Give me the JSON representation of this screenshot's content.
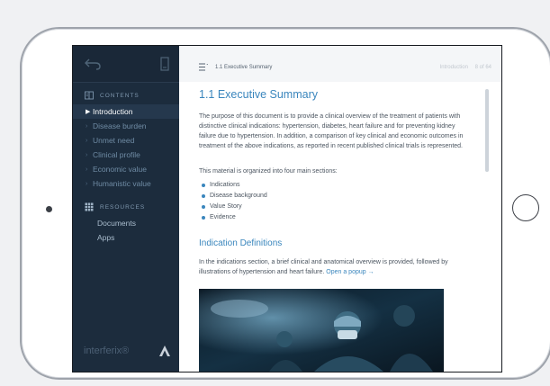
{
  "sidebar": {
    "contents_heading": "CONTENTS",
    "nav_items": [
      {
        "label": "Introduction",
        "active": true
      },
      {
        "label": "Disease burden",
        "active": false
      },
      {
        "label": "Unmet need",
        "active": false
      },
      {
        "label": "Clinical profile",
        "active": false
      },
      {
        "label": "Economic value",
        "active": false
      },
      {
        "label": "Humanistic value",
        "active": false
      }
    ],
    "resources_heading": "RESOURCES",
    "resources": [
      "Documents",
      "Apps"
    ],
    "brand": "interferix®"
  },
  "topbar": {
    "title": "1.1 Executive Summary",
    "section": "Introduction",
    "page": "8 of 64"
  },
  "content": {
    "heading": "1.1 Executive Summary",
    "paragraph1": "The purpose of this document is to provide a clinical overview of the treatment of patients with distinctive clinical indications: hypertension, diabetes, heart failure and for preventing kidney failure due to hypertension. In addition, a comparison of key clinical and economic outcomes in treatment of the above indications, as reported in recent published clinical trials is represented.",
    "paragraph2": "This material is organized into four main sections:",
    "sections": [
      "Indications",
      "Disease background",
      "Value Story",
      "Evidence"
    ],
    "subheading": "Indication Definitions",
    "paragraph3": "In the indications section, a brief clinical and anatomical overview is provided, followed by illustrations of hypertension and heart failure.",
    "popup_link": "Open a popup →"
  },
  "icons": {
    "back": "back-arrow-icon",
    "bookmark": "bookmark-icon",
    "contents": "book-icon",
    "resources": "grid-icon",
    "toc": "list-icon",
    "brand_mark": "logo-a-icon"
  },
  "colors": {
    "sidebar_bg": "#1c2c3d",
    "active_item_bg": "#25384d",
    "accent": "#3a86bd",
    "body_text": "#4b5560"
  }
}
